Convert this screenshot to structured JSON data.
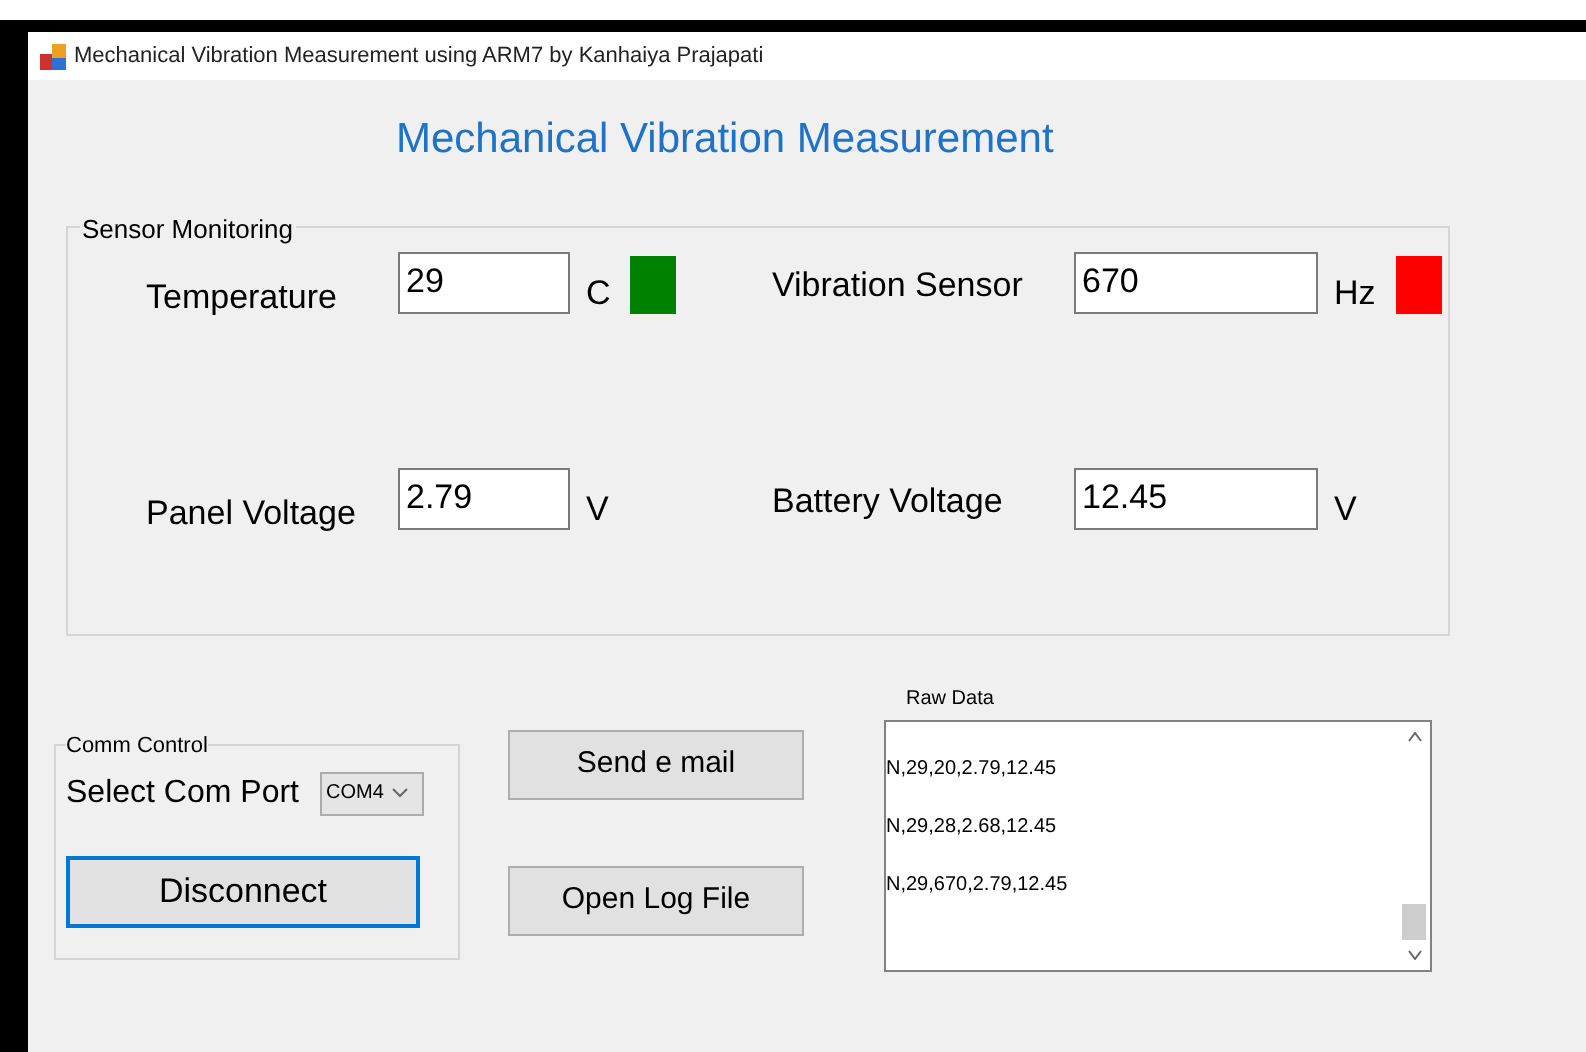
{
  "window": {
    "title": "Mechanical Vibration Measurement using ARM7 by Kanhaiya Prajapati"
  },
  "heading": "Mechanical Vibration Measurement",
  "sensor_group": {
    "title": "Sensor Monitoring",
    "sensors": [
      {
        "label": "Temperature",
        "value": "29",
        "unit": "C",
        "color": "#008000"
      },
      {
        "label": "Vibration Sensor",
        "value": "670",
        "unit": "Hz",
        "color": "#ff0000"
      },
      {
        "label": "Panel Voltage",
        "value": "2.79",
        "unit": "V"
      },
      {
        "label": "Battery Voltage",
        "value": "12.45",
        "unit": "V"
      }
    ]
  },
  "comm_control": {
    "title": "Comm Control",
    "port_label": "Select Com Port",
    "port": "COM4",
    "connect_button": {
      "label": "Disconnect",
      "focused": true
    }
  },
  "buttons": [
    "Send e mail",
    "Open Log File"
  ],
  "raw_data": {
    "label": "Raw Data",
    "lines": [
      "N,29,20,2.79,12.45",
      "N,29,28,2.68,12.45",
      "N,29,670,2.79,12.45"
    ]
  }
}
